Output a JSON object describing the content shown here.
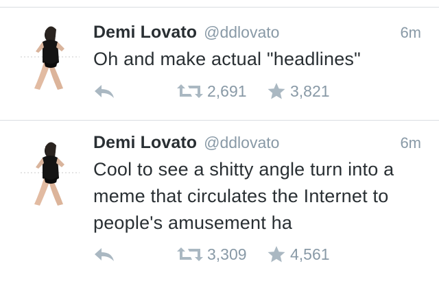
{
  "tweets": [
    {
      "name": "Demi Lovato",
      "handle": "@ddlovato",
      "time": "6m",
      "text": "Oh and make actual \"headlines\"",
      "retweets": "2,691",
      "favorites": "3,821"
    },
    {
      "name": "Demi Lovato",
      "handle": "@ddlovato",
      "time": "6m",
      "text": "Cool to see a shitty angle turn into a meme that circulates the Internet to people's amusement ha",
      "retweets": "3,309",
      "favorites": "4,561"
    }
  ],
  "colors": {
    "text": "#292f33",
    "muted": "#8899a6",
    "icon": "#aab8c2",
    "divider": "#d9dde1"
  },
  "icons": [
    "reply-icon",
    "retweet-icon",
    "star-icon"
  ]
}
